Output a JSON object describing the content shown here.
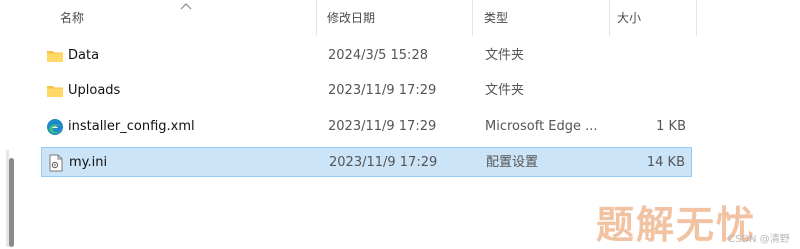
{
  "header": {
    "name_label": "名称",
    "date_label": "修改日期",
    "type_label": "类型",
    "size_label": "大小"
  },
  "files": [
    {
      "name": "Data",
      "date": "2024/3/5 15:28",
      "type": "文件夹",
      "size": "",
      "icon": "folder-icon",
      "selected": false
    },
    {
      "name": "Uploads",
      "date": "2023/11/9 17:29",
      "type": "文件夹",
      "size": "",
      "icon": "folder-icon",
      "selected": false
    },
    {
      "name": "installer_config.xml",
      "date": "2023/11/9 17:29",
      "type": "Microsoft Edge ...",
      "size": "1 KB",
      "icon": "edge-icon",
      "selected": false
    },
    {
      "name": "my.ini",
      "date": "2023/11/9 17:29",
      "type": "配置设置",
      "size": "14 KB",
      "icon": "ini-file-icon",
      "selected": true
    }
  ],
  "colors": {
    "selection_bg": "#cce4f7",
    "selection_border": "#99c9ef",
    "folder": "#f4c542",
    "edge_blue": "#1e88c8",
    "edge_green": "#3cc07a"
  },
  "watermark": {
    "text": "题解无忧",
    "source": "CSDN @清野"
  }
}
